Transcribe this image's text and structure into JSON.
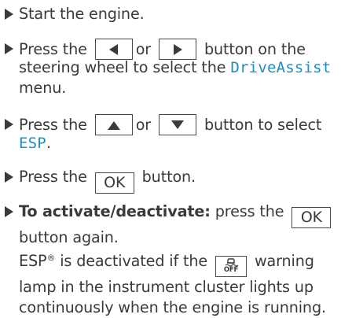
{
  "steps": [
    {
      "text": "Start the engine."
    },
    {
      "pre": "Press the",
      "mid": "or",
      "post": "button on the",
      "line2_pre": "steering wheel to select the",
      "menu": "DriveAssist",
      "line3": "menu."
    },
    {
      "pre": "Press the",
      "mid": "or",
      "post": "button to select",
      "menu": "ESP",
      "menu_suffix": "."
    },
    {
      "pre": "Press the",
      "key": "OK",
      "post": "button."
    },
    {
      "bold": "To activate/deactivate:",
      "pre": "press the",
      "key": "OK",
      "line2": "button again.",
      "line3_pre": "ESP",
      "reg": "®",
      "line3_mid": "is deactivated if the",
      "lamp_label": "OFF",
      "line3_post": "warning",
      "line4": "lamp in the instrument cluster lights up",
      "line5": "continuously when the engine is running."
    }
  ],
  "icons": {
    "bullet": "triangle-right-bullet",
    "left": "arrow-left-key-icon",
    "right": "arrow-right-key-icon",
    "up": "arrow-up-key-icon",
    "down": "arrow-down-key-icon",
    "lamp": "esp-off-warning-lamp-icon"
  },
  "colors": {
    "text": "#3a3a3a",
    "menu": "#1e8dbf"
  }
}
